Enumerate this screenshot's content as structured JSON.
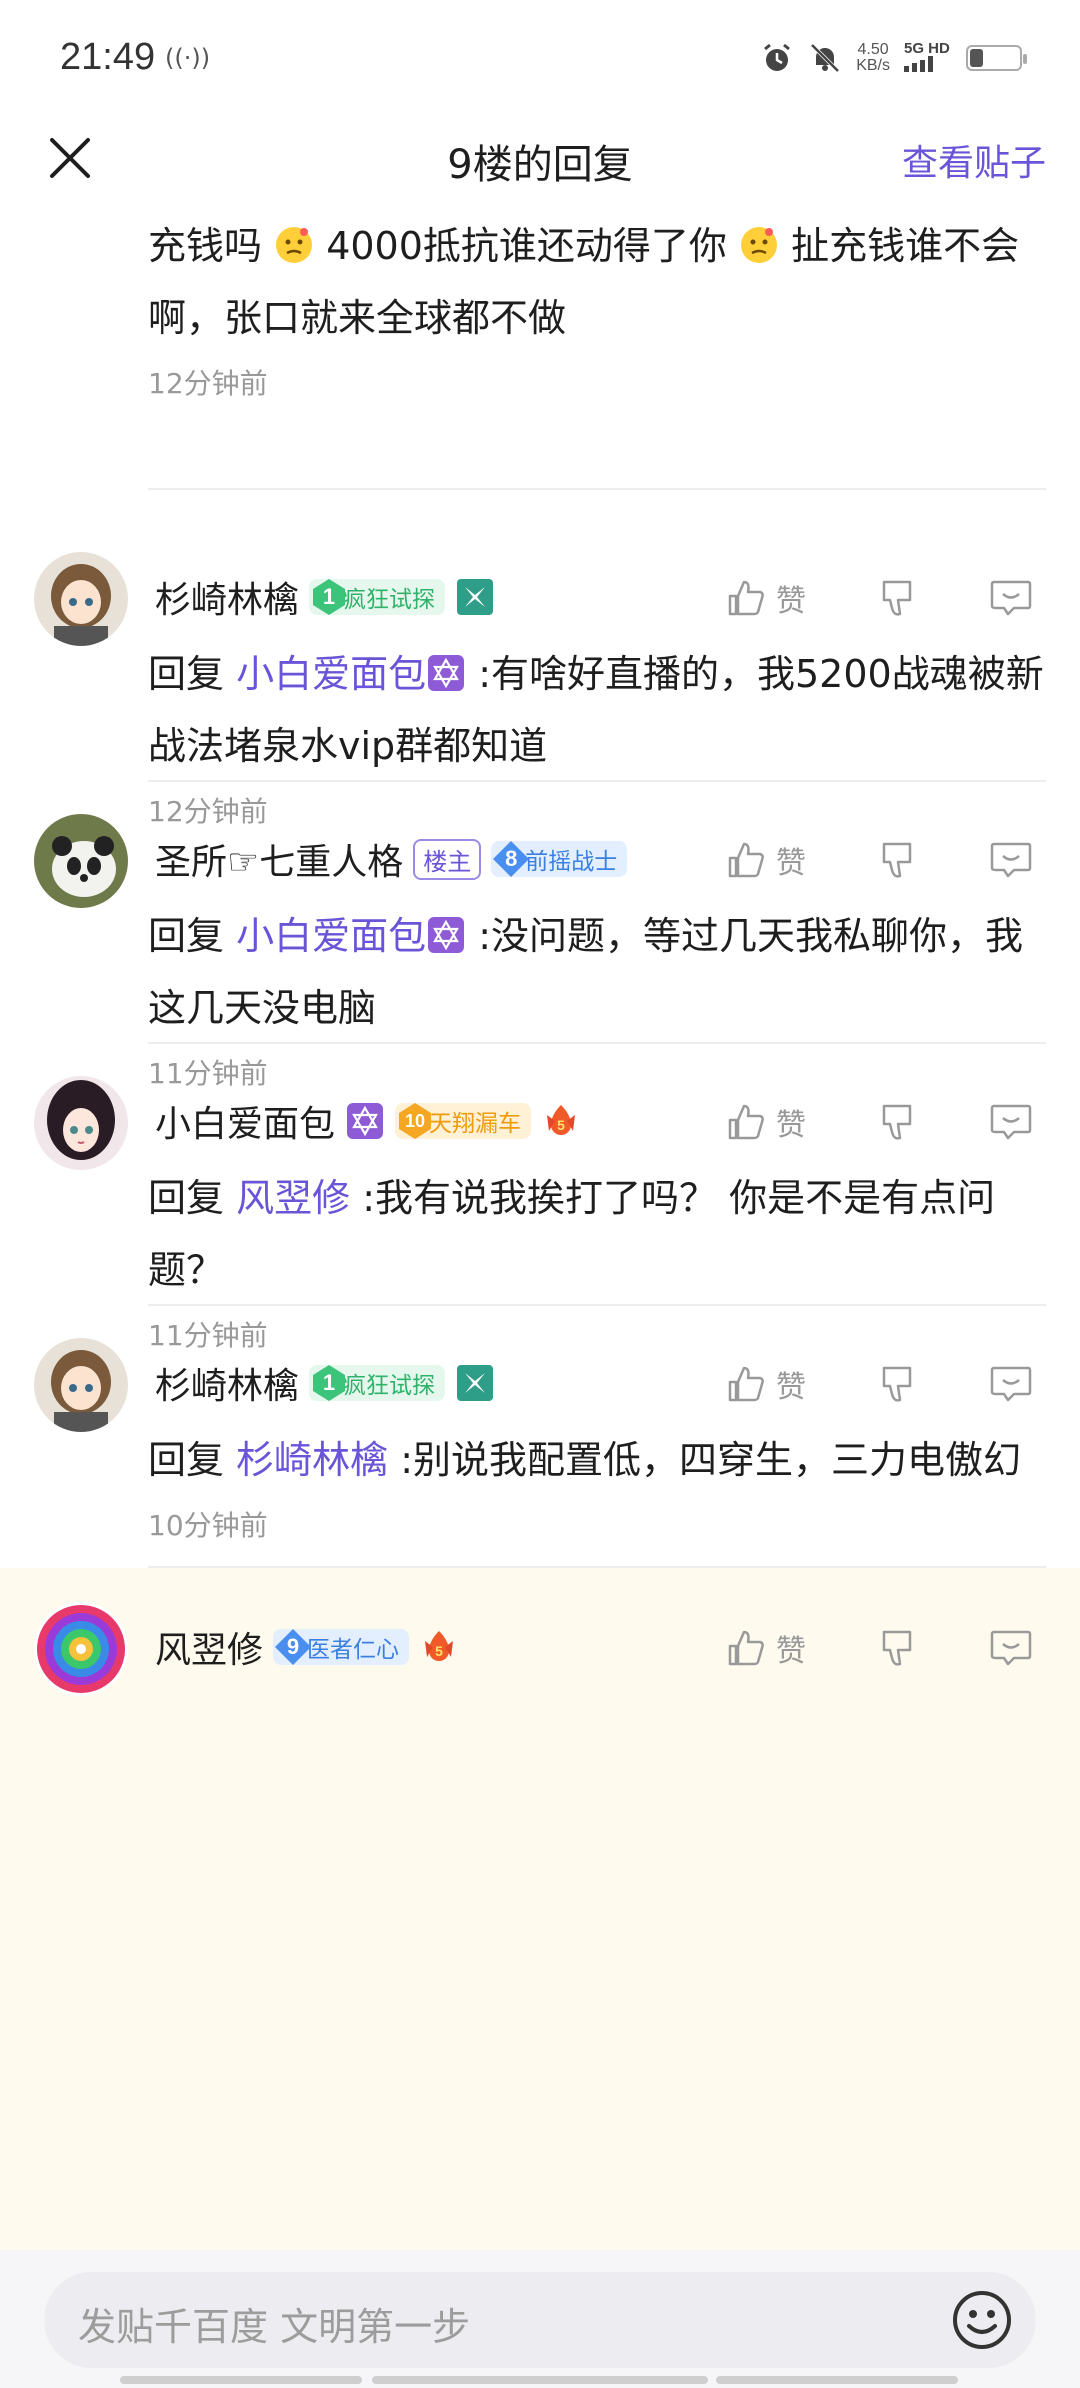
{
  "status_bar": {
    "time": "21:49",
    "net_speed_value": "4.50",
    "net_speed_unit": "KB/s",
    "net_type": "5G HD",
    "battery_level": 0.25
  },
  "header": {
    "title": "9楼的回复",
    "view_post_link": "查看贴子"
  },
  "top_partial": {
    "text_line1": "充钱吗 ",
    "text_mid": "4000抵抗谁还动得了你 ",
    "text_tail": "扯充钱谁不会啊，张口就来全球都不做",
    "time": "12分钟前"
  },
  "comments": [
    {
      "name": "杉崎林檎",
      "badge_level": "1",
      "badge_text": "疯狂试探",
      "reply_prefix": "回复 ",
      "mention": "小白爱面包",
      "text": " :有啥好直播的，我5200战魂被新战法堵泉水vip群都知道",
      "time": "12分钟前"
    },
    {
      "name": "圣所☞七重人格",
      "owner_tag": "楼主",
      "badge_level": "8",
      "badge_text": "前摇战士",
      "reply_prefix": "回复 ",
      "mention": "小白爱面包",
      "text": " :没问题，等过几天我私聊你，我这几天没电脑",
      "time": "11分钟前"
    },
    {
      "name": "小白爱面包",
      "badge_level": "10",
      "badge_text": "天翔漏车",
      "reply_prefix": "回复 ",
      "mention": "风翌修",
      "text": " :我有说我挨打了吗？ 你是不是有点问题？",
      "time": "11分钟前"
    },
    {
      "name": "杉崎林檎",
      "badge_level": "1",
      "badge_text": "疯狂试探",
      "reply_prefix": "回复 ",
      "mention": "杉崎林檎",
      "text": " :别说我配置低，四穿生，三力电傲幻",
      "time": "10分钟前"
    },
    {
      "name": "风翌修",
      "badge_level": "9",
      "badge_text": "医者仁心"
    }
  ],
  "actions": {
    "like_label": "赞"
  },
  "bottom": {
    "input_placeholder": "发贴千百度 文明第一步"
  },
  "colors": {
    "accent": "#6a54d8",
    "highlight_bg": "#fefaee"
  }
}
